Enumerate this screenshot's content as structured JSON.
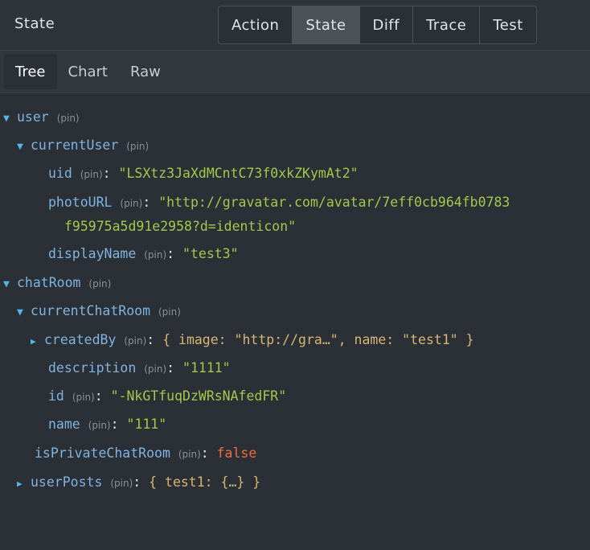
{
  "header": {
    "title": "State",
    "modes": [
      "Action",
      "State",
      "Diff",
      "Trace",
      "Test"
    ],
    "active_mode": "State"
  },
  "tabs": {
    "items": [
      "Tree",
      "Chart",
      "Raw"
    ],
    "active": "Tree"
  },
  "tree": {
    "pin_label": "(pin)",
    "user_key": "user",
    "currentUser_key": "currentUser",
    "uid_key": "uid",
    "uid_value": "\"LSXtz3JaXdMCntC73f0xkZKymAt2\"",
    "photoURL_key": "photoURL",
    "photoURL_value_line1": "\"http://gravatar.com/avatar/7eff0cb964fb0783",
    "photoURL_value_line2": "f95975a5d91e2958?d=identicon\"",
    "displayName_key": "displayName",
    "displayName_value": "\"test3\"",
    "chatRoom_key": "chatRoom",
    "currentChatRoom_key": "currentChatRoom",
    "createdBy_key": "createdBy",
    "createdBy_value": "{ image: \"http://gra…\", name: \"test1\" }",
    "description_key": "description",
    "description_value": "\"1111\"",
    "id_key": "id",
    "id_value": "\"-NkGTfuqDzWRsNAfedFR\"",
    "name_key": "name",
    "name_value": "\"111\"",
    "isPrivate_key": "isPrivateChatRoom",
    "isPrivate_value": "false",
    "userPosts_key": "userPosts",
    "userPosts_value": "{ test1: {…} }",
    "expanded_glyph": "▼",
    "collapsed_glyph": "▶"
  }
}
